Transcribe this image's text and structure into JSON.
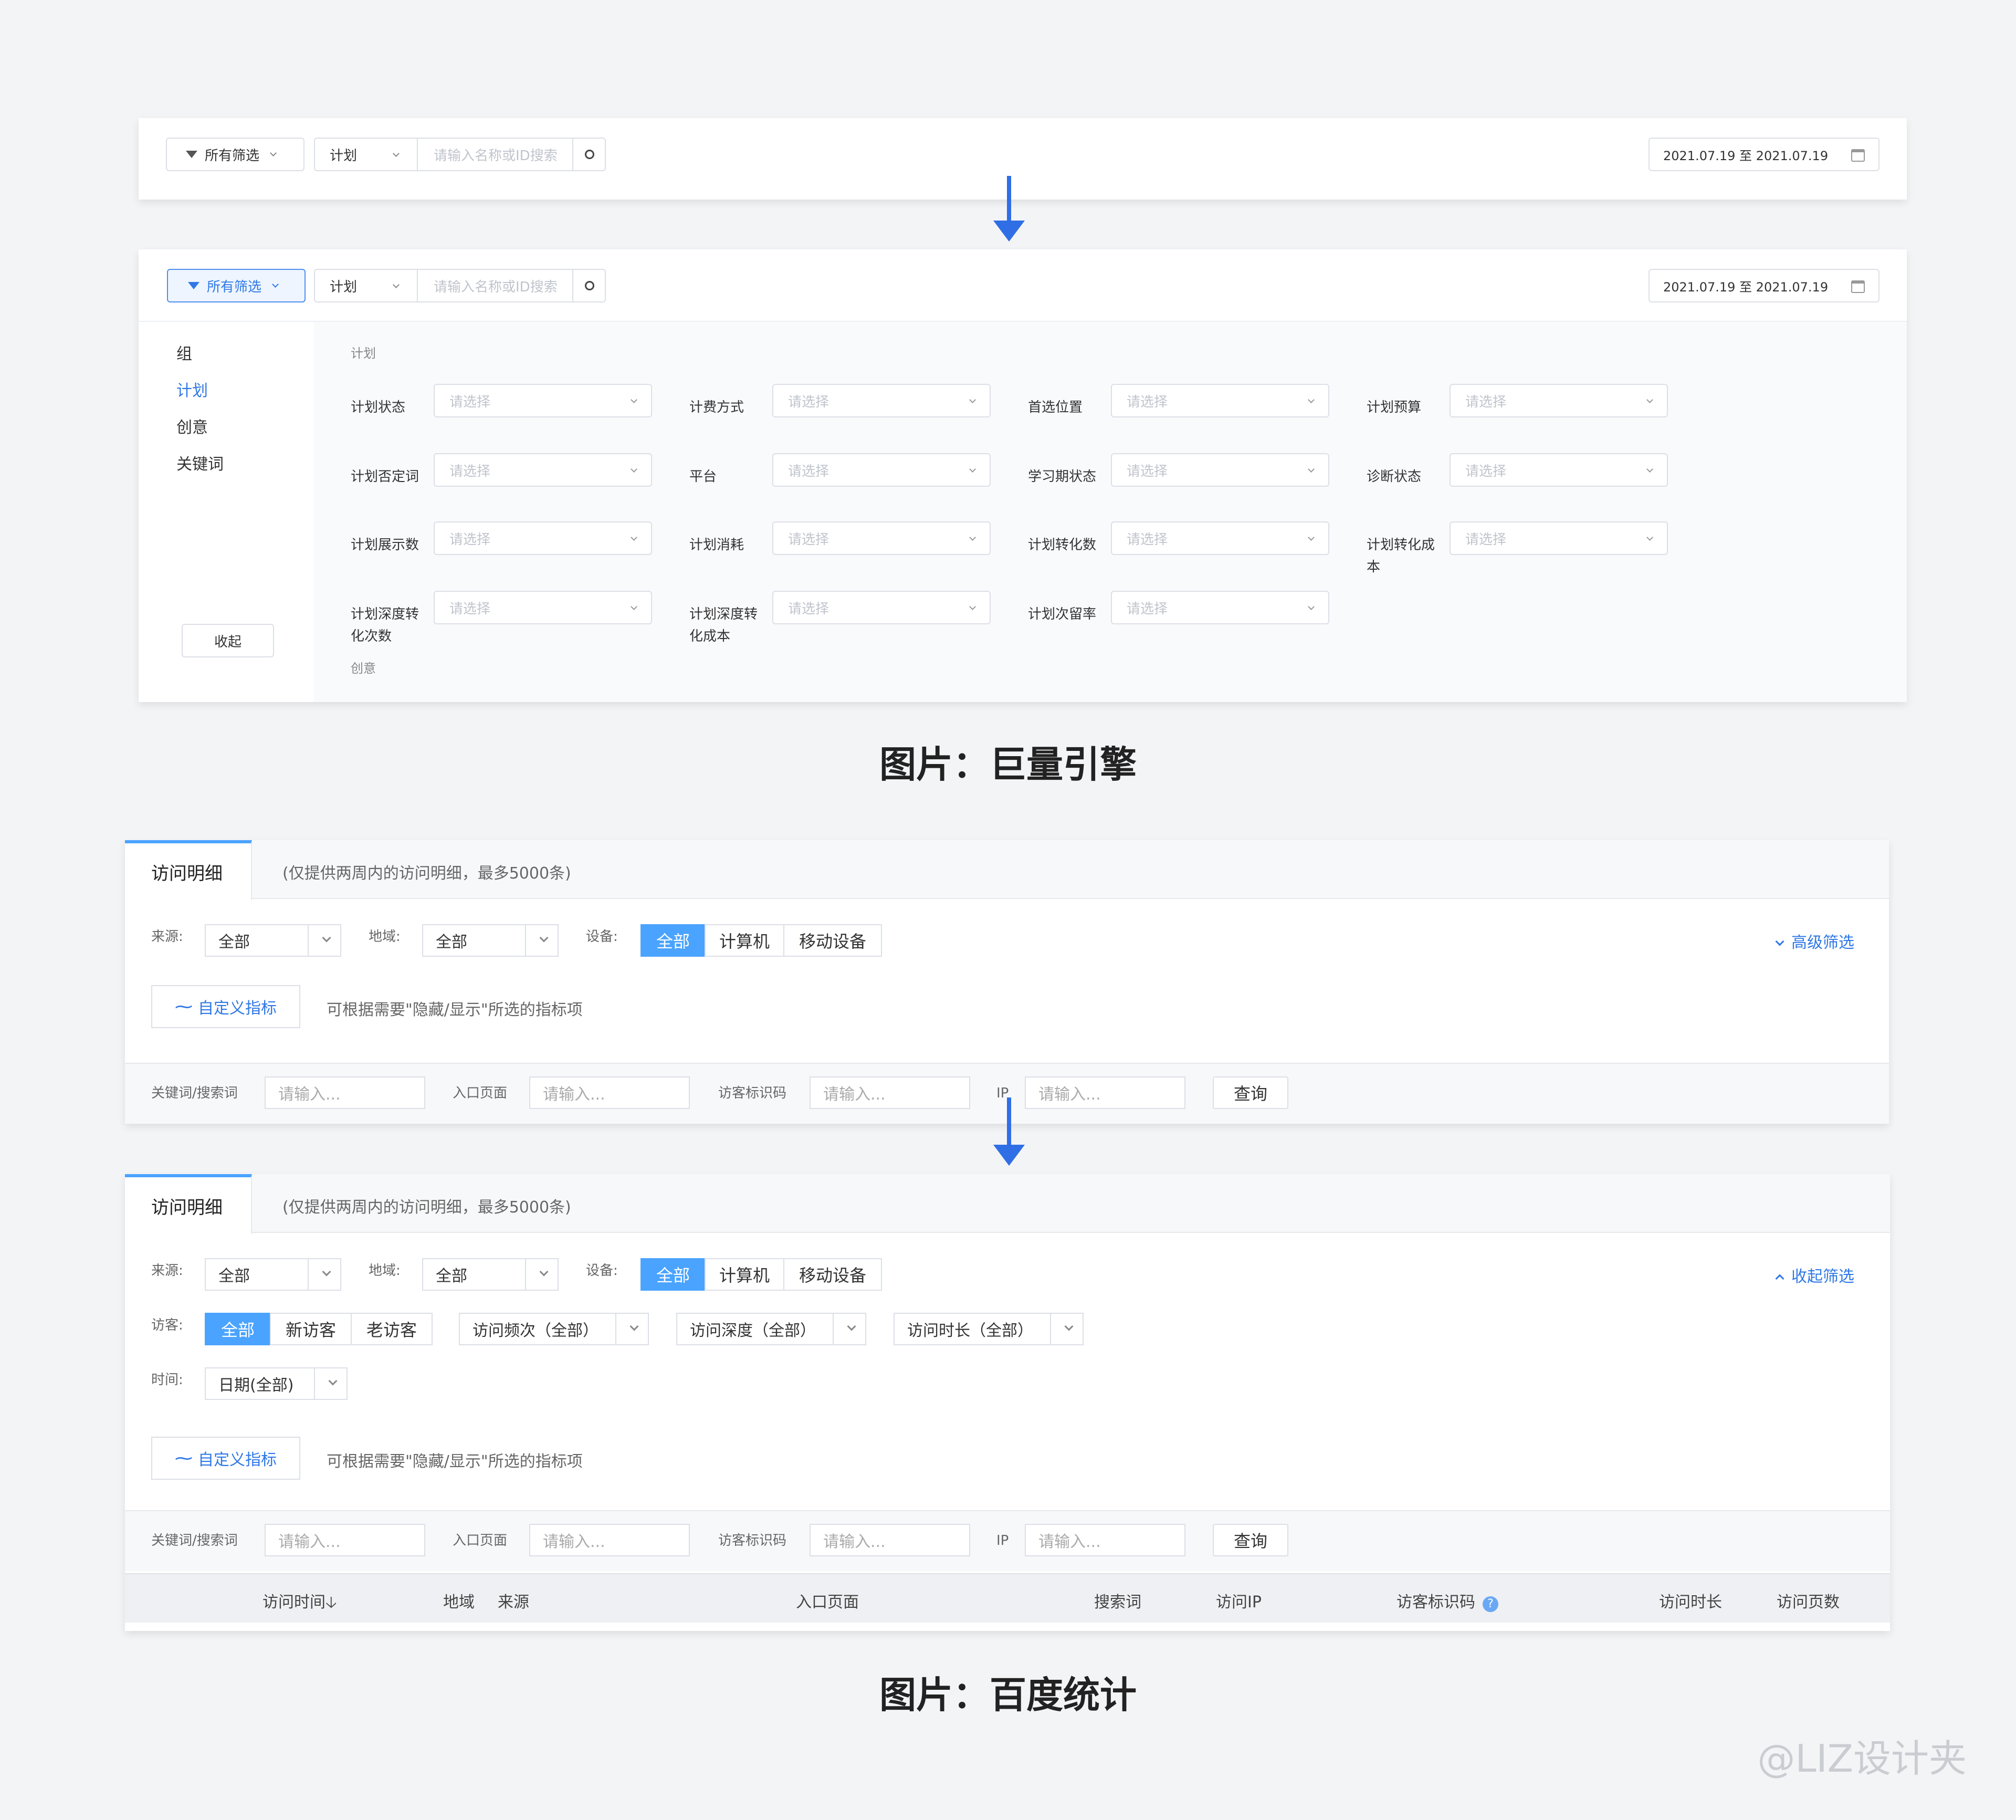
{
  "jl": {
    "filters_label": "所有筛选",
    "plan_select": "计划",
    "search_placeholder": "请输入名称或ID搜索",
    "date_range": "2021.07.19 至 2021.07.19",
    "sidebar": [
      "组",
      "计划",
      "创意",
      "关键词"
    ],
    "collapse": "收起",
    "section_plan": "计划",
    "section_creative": "创意",
    "placeholder": "请选择",
    "fields": [
      [
        "计划状态",
        "计费方式",
        "首选位置",
        "计划预算"
      ],
      [
        "计划否定词",
        "平台",
        "学习期状态",
        "诊断状态"
      ],
      [
        "计划展示数",
        "计划消耗",
        "计划转化数",
        "计划转化成本"
      ],
      [
        "计划深度转化次数",
        "计划深度转化成本",
        "计划次留率"
      ]
    ],
    "caption": "图片：巨量引擎"
  },
  "bd": {
    "tab": "访问明细",
    "note": "(仅提供两周内的访问明细，最多5000条)",
    "source_label": "来源:",
    "source_value": "全部",
    "region_label": "地域:",
    "region_value": "全部",
    "device_label": "设备:",
    "device_options": [
      "全部",
      "计算机",
      "移动设备"
    ],
    "adv_filter": "高级筛选",
    "collapse_filter": "收起筛选",
    "custom_metric": "自定义指标",
    "custom_hint": "可根据需要\"隐藏/显示\"所选的指标项",
    "keyword_label": "关键词/搜索词",
    "entry_label": "入口页面",
    "visitor_code_label": "访客标识码",
    "ip_label": "IP",
    "input_placeholder": "请输入...",
    "query": "查询",
    "visitor_label": "访客:",
    "visitor_options": [
      "全部",
      "新访客",
      "老访客"
    ],
    "freq": "访问频次（全部）",
    "depth": "访问深度（全部）",
    "duration": "访问时长（全部）",
    "time_label": "时间:",
    "time_value": "日期(全部)",
    "columns": [
      "访问时间",
      "地域",
      "来源",
      "入口页面",
      "搜索词",
      "访问IP",
      "访客标识码",
      "访问时长",
      "访问页数"
    ],
    "caption": "图片：百度统计"
  },
  "watermark": "@LIZ设计夹"
}
